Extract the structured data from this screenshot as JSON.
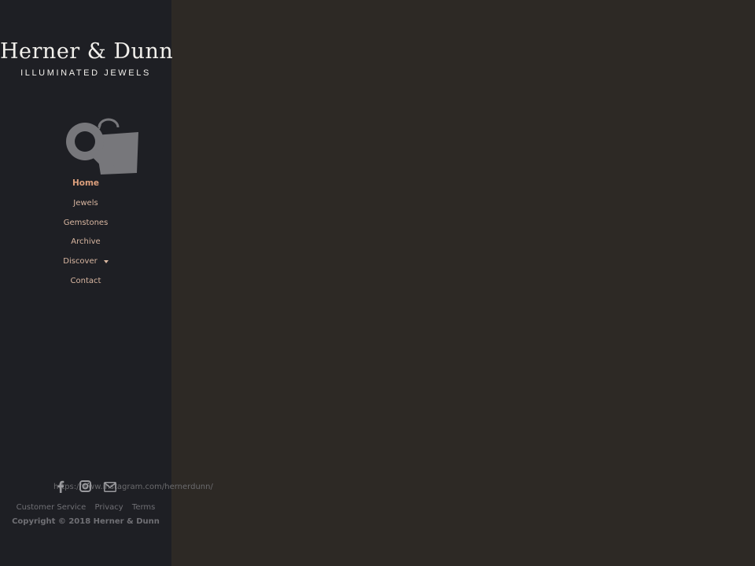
{
  "brand": {
    "name": "Herner & Dunn",
    "tagline": "ILLUMINATED JEWELS"
  },
  "icons": {
    "search_shop": "search-bag-icon",
    "facebook": "facebook-icon",
    "instagram": "instagram-icon",
    "email": "mail-icon",
    "discover_caret": "caret-down-icon"
  },
  "nav": {
    "items": [
      {
        "label": "Home",
        "active": true
      },
      {
        "label": "Jewels",
        "active": false
      },
      {
        "label": "Gemstones",
        "active": false
      },
      {
        "label": "Archive",
        "active": false
      },
      {
        "label": "Discover",
        "active": false,
        "has_dropdown": true
      },
      {
        "label": "Contact",
        "active": false
      }
    ]
  },
  "social": {
    "url_text": "https://www.instagram.com/hernerdunn/"
  },
  "footer": {
    "links": [
      "Customer Service",
      "Privacy",
      "Terms"
    ],
    "copyright": "Copyright © 2018 Herner & Dunn"
  },
  "colors": {
    "sidebar_bg": "#1e1f24",
    "main_bg": "#2d2925",
    "nav_text": "#d9b7a1",
    "nav_active": "#dc9f7c"
  }
}
